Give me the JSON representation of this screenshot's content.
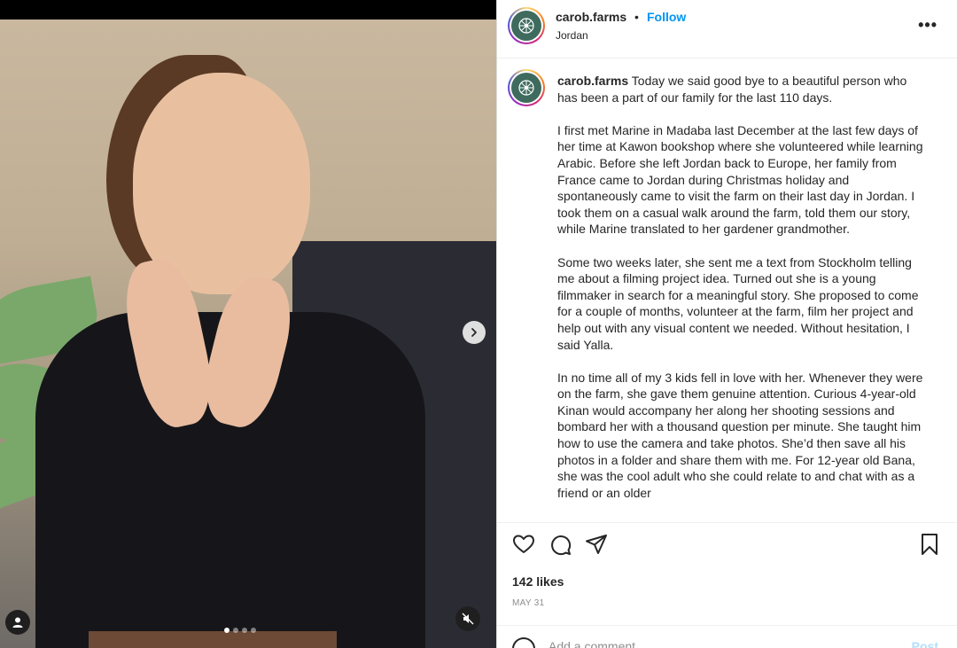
{
  "post": {
    "username": "carob.farms",
    "separator": "•",
    "follow_label": "Follow",
    "location": "Jordan",
    "more_label": "•••",
    "caption_intro": "Today we said good bye to a beautiful person who has been a part of our family for the last 110 days.",
    "paragraphs": [
      "I first met Marine in Madaba last December at the last few days of her time at Kawon bookshop where she volunteered while learning Arabic. Before she left Jordan back to Europe, her family from France came to Jordan during Christmas holiday and spontaneously came to visit the farm on their last day in Jordan. I took them on a casual walk around the farm, told them our story, while Marine translated to her gardener grandmother.",
      "Some two weeks later, she sent me a text from Stockholm telling me about a filming project idea. Turned out she is a young filmmaker in search for a meaningful story. She proposed to come for a couple of months, volunteer at the farm, film her project and help out with any visual content we needed. Without hesitation, I said Yalla.",
      "In no time all of my 3 kids fell in love with her. Whenever they were on the farm, she gave them genuine attention. Curious 4-year-old Kinan would accompany her along her shooting sessions and bombard her with a thousand question per minute. She taught him how to use the camera and take photos. She’d then save all his photos in a folder and share them with me. For 12-year old Bana, she was the cool adult who she could relate to and chat with as a friend or an older"
    ],
    "likes": "142 likes",
    "date": "MAY 31",
    "comment_placeholder": "Add a comment…",
    "post_label": "Post"
  },
  "media": {
    "carousel_count": 4,
    "active_index": 0
  },
  "icons": {
    "like": "heart-icon",
    "comment": "comment-icon",
    "share": "share-icon",
    "save": "bookmark-icon",
    "next": "chevron-right-icon",
    "tag": "user-tag-icon",
    "mute": "muted-speaker-icon",
    "emoji": "emoji-icon"
  },
  "colors": {
    "accent": "#0095f6",
    "post_disabled": "#b2dffc",
    "logo_bg": "#3e6b5d"
  }
}
